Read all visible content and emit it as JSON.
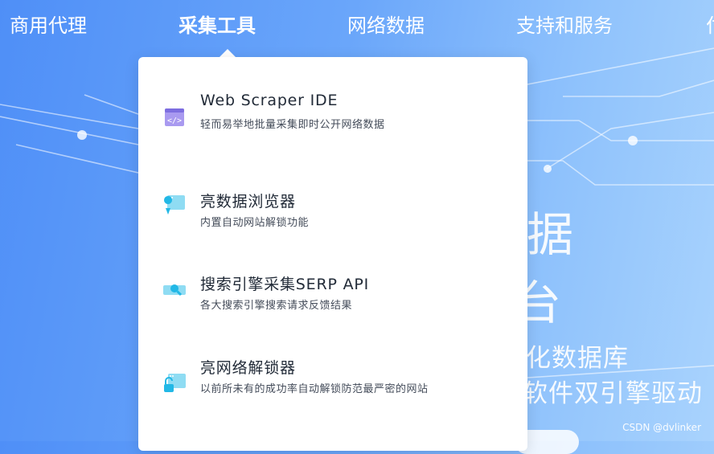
{
  "nav": {
    "items": [
      "商用代理",
      "采集工具",
      "网络数据",
      "支持和服务",
      "付"
    ],
    "active_index": 1
  },
  "menu": {
    "items": [
      {
        "title": "Web Scraper IDE",
        "desc": "轻而易举地批量采集即时公开网络数据",
        "icon": "code-window-icon"
      },
      {
        "title": "亮数据浏览器",
        "desc": "内置自动网站解锁功能",
        "icon": "browser-pin-icon"
      },
      {
        "title": "搜索引擎采集SERP API",
        "desc": "各大搜索引擎搜索请求反馈结果",
        "icon": "search-window-icon"
      },
      {
        "title": "亮网络解锁器",
        "desc": "以前所未有的成功率自动解锁防范最严密的网站",
        "icon": "unlock-window-icon"
      }
    ]
  },
  "hero": {
    "line1": "据",
    "line2": "台",
    "line3": "构化数据库",
    "line4": "软件双引擎驱动"
  },
  "watermark": "CSDN @dvlinker",
  "colors": {
    "accent_blue": "#4f8ff7",
    "icon_cyan": "#22b8e6",
    "icon_purple": "#8b7fe8"
  }
}
